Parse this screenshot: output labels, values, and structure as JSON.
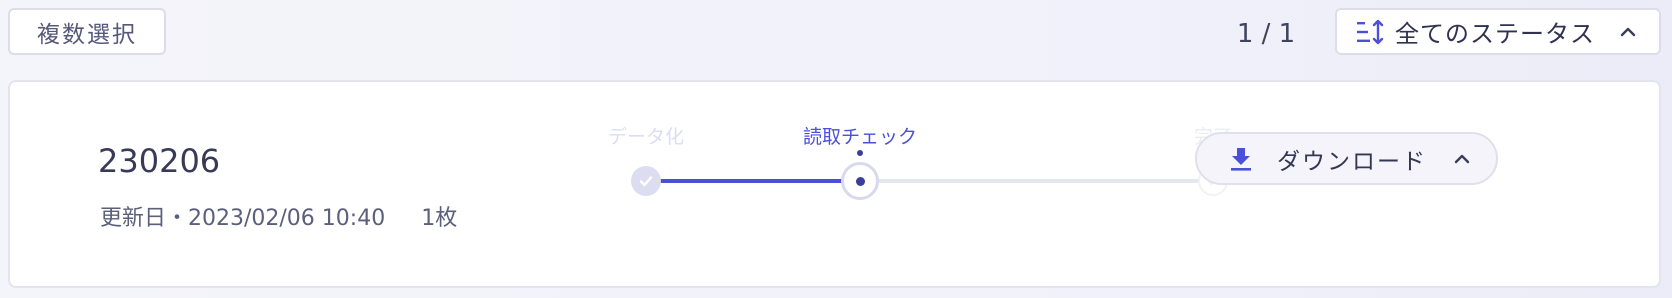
{
  "toolbar": {
    "multi_select_label": "複数選択",
    "pager_text": "1 / 1",
    "status_filter_label": "全てのステータス",
    "sort_icon": "sort-icon",
    "chevron_icon": "chevron-up-icon"
  },
  "colors": {
    "accent": "#4a50d8",
    "background": "#f2f3fa",
    "card": "#ffffff",
    "text": "#3a3e5c"
  },
  "document": {
    "name": "230206",
    "updated": "更新日・2023/02/06 10:40",
    "page_count": "1枚",
    "progress": {
      "steps": [
        "データ化",
        "読取チェック",
        "完了"
      ],
      "current_step": 1
    },
    "download_label": "ダウンロード",
    "download_icon": "download-icon"
  }
}
